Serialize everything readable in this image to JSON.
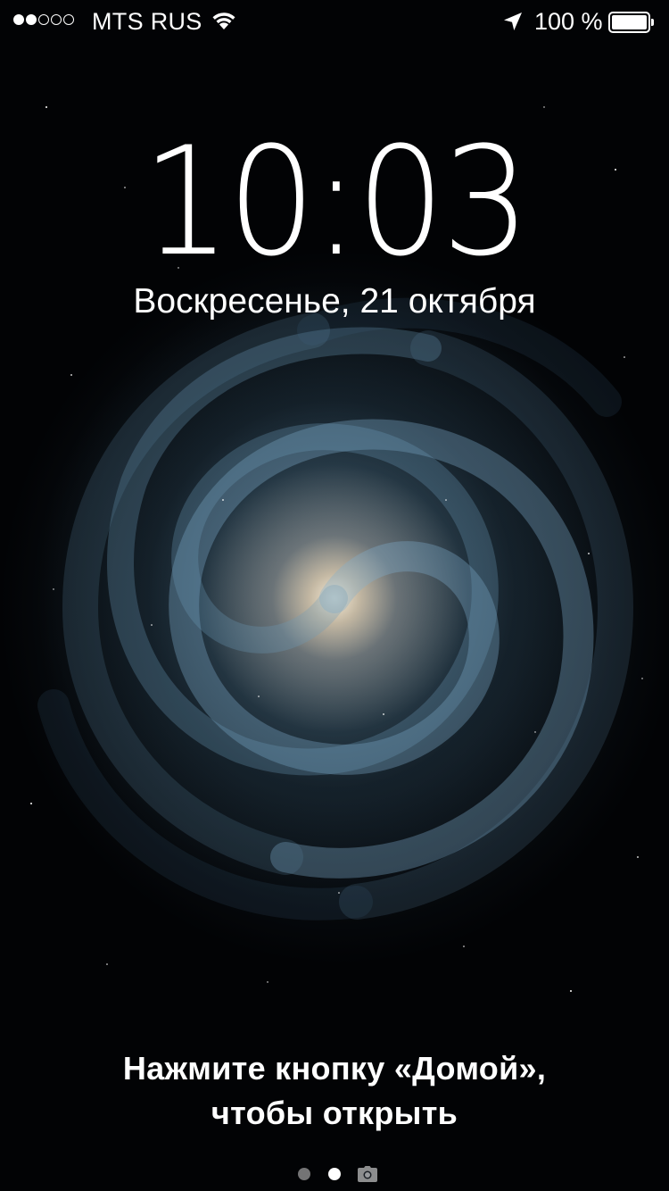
{
  "status_bar": {
    "signal_strength": 2,
    "signal_max": 5,
    "carrier": "MTS RUS",
    "wifi_icon": "wifi-icon",
    "location_icon": "location-arrow-icon",
    "battery_percent": "100 %",
    "battery_level": 1.0
  },
  "lock_screen": {
    "time": "10:03",
    "date": "Воскресенье, 21 октября",
    "unlock_line1": "Нажмите кнопку «Домой»,",
    "unlock_line2": "чтобы открыть"
  },
  "pager": {
    "pages": 2,
    "current_page": 2,
    "camera_icon": "camera-icon"
  },
  "wallpaper": {
    "description_colors": {
      "core": "#f3e4cc",
      "arms": "#6f97b2",
      "space": "#020305"
    }
  }
}
